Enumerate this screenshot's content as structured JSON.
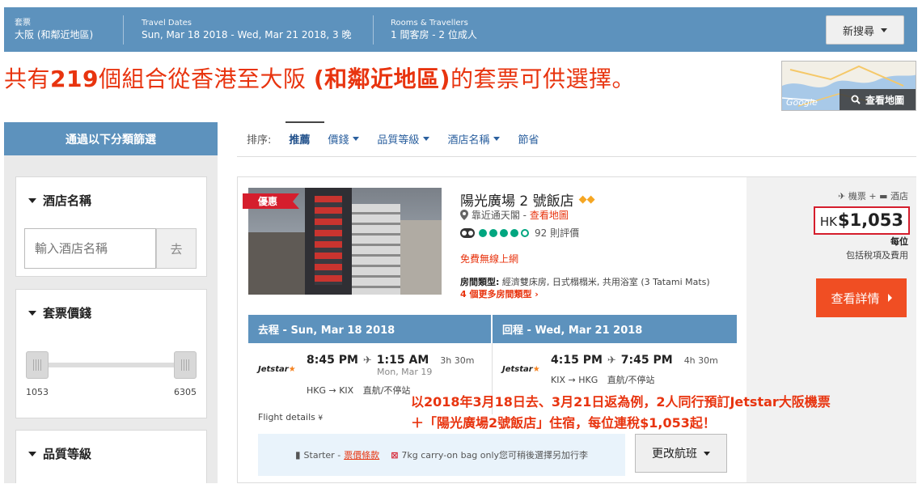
{
  "search": {
    "package_label": "套票",
    "package_value": "大阪 (和鄰近地區)",
    "dates_label": "Travel Dates",
    "dates_value": "Sun, Mar 18 2018 - Wed, Mar 21 2018, 3 晚",
    "rooms_label": "Rooms & Travellers",
    "rooms_value": "1 間客房 - 2 位成人",
    "new_search_label": "新搜尋"
  },
  "headline": {
    "prefix": "共有",
    "count": "219",
    "middle": "個組合從香港至大阪 ",
    "bold_region": "(和鄰近地區)",
    "suffix": "的套票可供選擇。"
  },
  "map": {
    "google": "Google",
    "view_map_label": "查看地圖"
  },
  "filters": {
    "header": "通過以下分類篩選",
    "hotel_name_title": "酒店名稱",
    "hotel_name_placeholder": "輸入酒店名稱",
    "go_label": "去",
    "price_title": "套票價錢",
    "price_min": "1053",
    "price_max": "6305",
    "quality_title": "品質等級"
  },
  "sort": {
    "label": "排序:",
    "items": [
      "推薦",
      "價錢",
      "品質等級",
      "酒店名稱",
      "節省"
    ]
  },
  "result": {
    "promo_tag": "優惠",
    "hotel_name": "陽光廣場 2 號飯店",
    "stars": "◆◆",
    "location": "靠近通天閣",
    "location_sep": " - ",
    "view_map_link": "查看地圖",
    "reviews": "92 則評價",
    "rating": 4,
    "wifi": "免費無線上網",
    "room_type_label": "房間類型:",
    "room_type_value": " 經濟雙床房, 日式榻榻米, 共用浴室 (3 Tatami Mats)",
    "more_room_types": "4 個更多房間類型 ›",
    "package_type": "✈ 機票 + ▬ 酒店",
    "currency": "HK",
    "price": "$1,053",
    "per_person": "每位",
    "tax_note": "包括稅項及費用",
    "details_button": "查看詳情",
    "outbound": {
      "header": "去程 - Sun, Mar 18 2018",
      "airline": "Jetstar",
      "depart": "8:45 PM",
      "arrive": "1:15 AM",
      "duration": "3h 30m",
      "arrive_date": "Mon, Mar 19",
      "route": "HKG → KIX",
      "stops": "直航/不停站"
    },
    "inbound": {
      "header": "回程 - Wed, Mar 21 2018",
      "airline": "Jetstar",
      "depart": "4:15 PM",
      "arrive": "7:45 PM",
      "duration": "4h 30m",
      "route": "KIX → HKG",
      "stops": "直航/不停站"
    },
    "flight_details": "Flight details",
    "fare_class": "Starter -",
    "fare_rules": "票價條款",
    "baggage_note": "7kg carry-on bag only您可稍後選擇另加行李",
    "change_flight": "更改航班"
  },
  "caption": {
    "line1": "以2018年3月18日去、3月21日返為例，2人同行預訂Jetstar大阪機票",
    "line2": "＋「陽光廣場2號飯店」住宿，每位連稅$1,053起！"
  },
  "colors": {
    "brand_blue": "#5d92bd",
    "accent_orange": "#f04e23",
    "headline_red": "#e8340f",
    "promo_red": "#d51e2d"
  }
}
